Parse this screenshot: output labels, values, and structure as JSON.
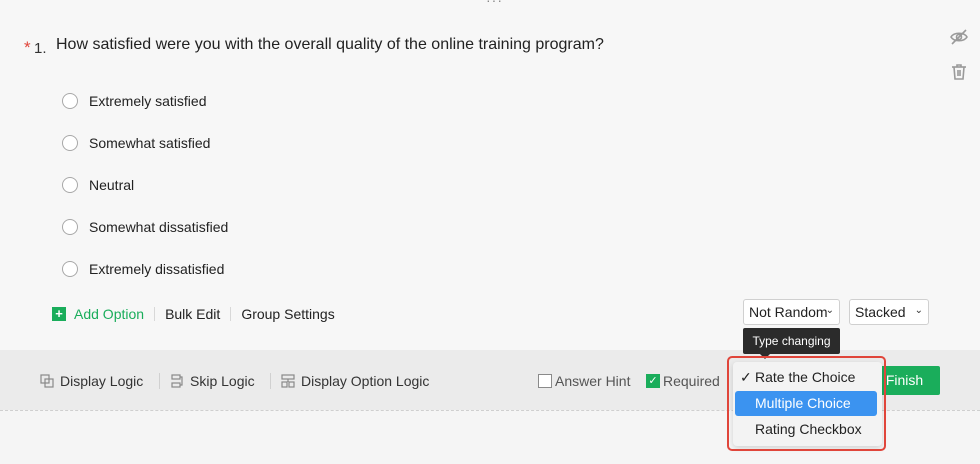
{
  "question": {
    "required_mark": "*",
    "number": "1.",
    "text": "How satisfied were you with the overall quality of the online training program?"
  },
  "options": [
    "Extremely satisfied",
    "Somewhat satisfied",
    "Neutral",
    "Somewhat dissatisfied",
    "Extremely dissatisfied"
  ],
  "toolbar": {
    "add_option": "Add Option",
    "bulk_edit": "Bulk Edit",
    "group_settings": "Group Settings",
    "random_select": "Not Random",
    "layout_select": "Stacked"
  },
  "tooltip": "Type changing",
  "logic": {
    "display_logic": "Display Logic",
    "skip_logic": "Skip Logic",
    "display_option_logic": "Display Option Logic"
  },
  "settings": {
    "answer_hint": "Answer Hint",
    "answer_hint_checked": false,
    "required": "Required",
    "required_checked": true
  },
  "finish_button": "Finish",
  "type_dropdown": {
    "items": [
      "Rate the Choice",
      "Multiple Choice",
      "Rating Checkbox"
    ],
    "checked_item": "Rate the Choice",
    "highlighted_item": "Multiple Choice"
  },
  "colors": {
    "accent_green": "#1aad5b",
    "highlight_blue": "#3b93f0",
    "outline_red": "#e0453a"
  }
}
